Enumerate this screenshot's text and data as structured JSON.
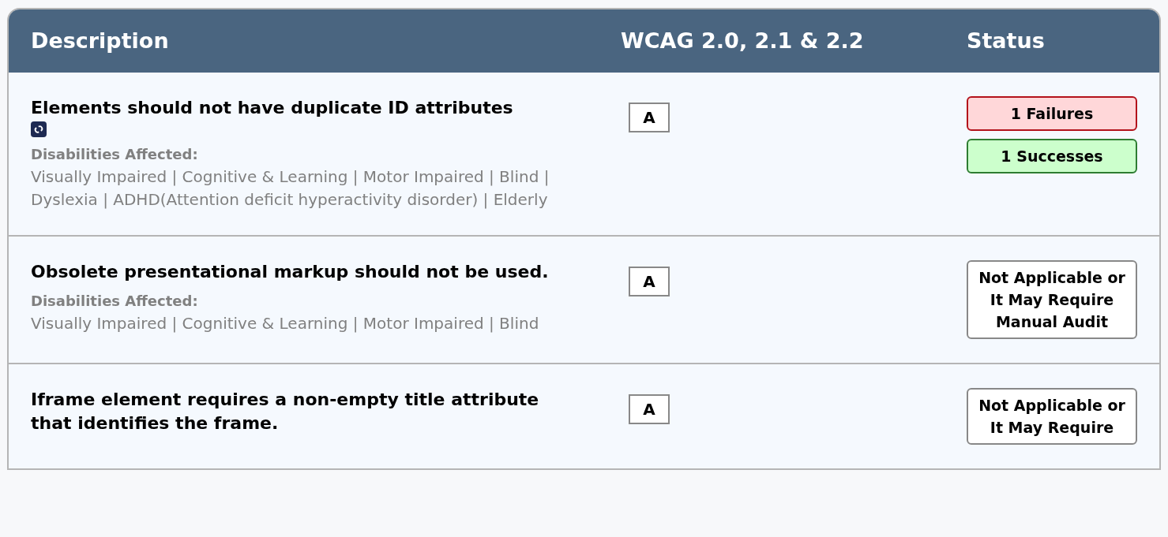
{
  "table": {
    "columns": [
      "Description",
      "WCAG 2.0, 2.1 & 2.2",
      "Status"
    ],
    "rows": [
      {
        "title": "Elements should not have duplicate ID attributes",
        "has_link": true,
        "disabilities_label": "Disabilities Affected:",
        "disabilities": "Visually Impaired | Cognitive & Learning | Motor Impaired | Blind | Dyslexia | ADHD(Attention deficit hyperactivity disorder) | Elderly",
        "level": "A",
        "statuses": [
          {
            "kind": "failures",
            "text": "1 Failures"
          },
          {
            "kind": "successes",
            "text": "1 Successes"
          }
        ]
      },
      {
        "title": "Obsolete presentational markup should not be used.",
        "has_link": false,
        "disabilities_label": "Disabilities Affected:",
        "disabilities": "Visually Impaired | Cognitive & Learning | Motor Impaired | Blind",
        "level": "A",
        "statuses": [
          {
            "kind": "not_applicable",
            "text": "Not Applicable or It May Require Manual Audit"
          }
        ]
      },
      {
        "title": "Iframe element requires a non-empty title attribute that identifies the frame.",
        "has_link": false,
        "level": "A",
        "statuses": [
          {
            "kind": "not_applicable",
            "text": "Not Applicable or It May Require"
          }
        ]
      }
    ]
  }
}
